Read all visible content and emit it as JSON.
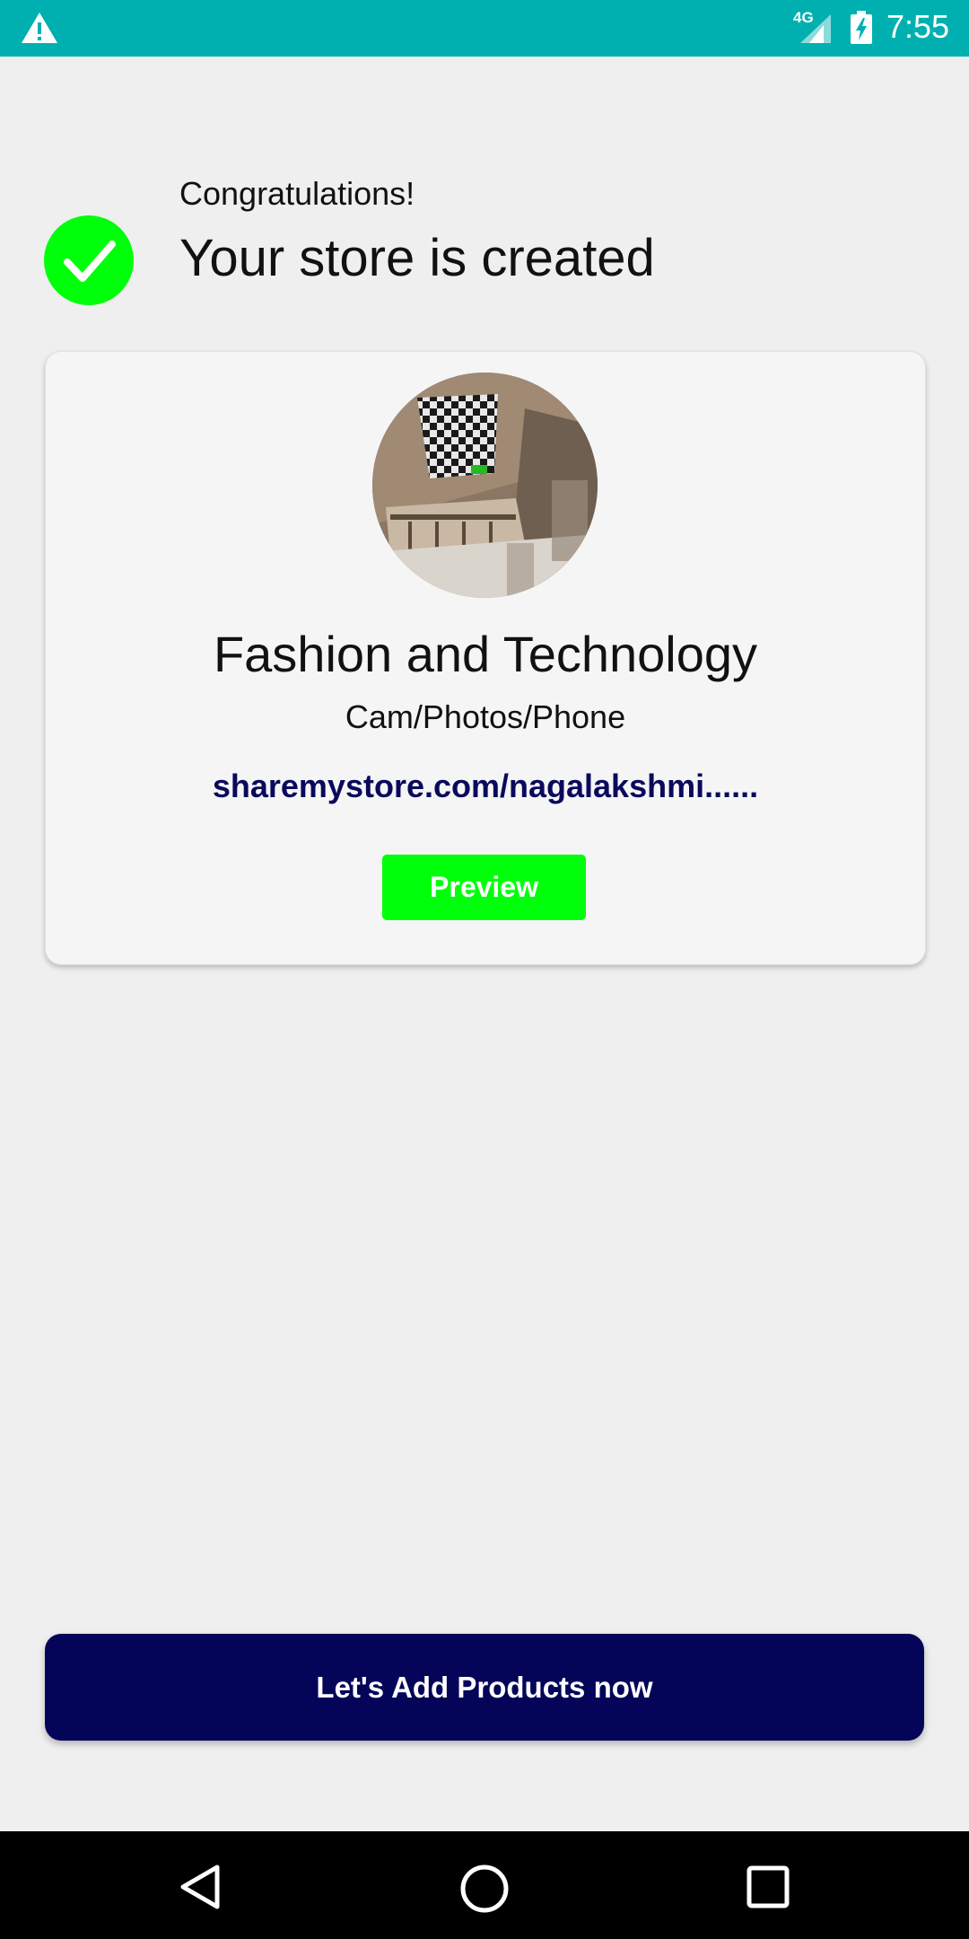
{
  "status_bar": {
    "network": "4G",
    "time": "7:55",
    "warning_icon": "warning-icon",
    "signal_icon": "signal-icon",
    "battery_icon": "battery-charging-icon"
  },
  "header": {
    "congrats": "Congratulations!",
    "message": "Your store is created",
    "check_icon": "check-circle-icon",
    "accent_color": "#00ff0a"
  },
  "store_card": {
    "name": "Fashion and Technology",
    "category": "Cam/Photos/Phone",
    "link": "sharemystore.com/nagalakshmi......",
    "preview_label": "Preview",
    "link_color": "#0a0a5c"
  },
  "cta": {
    "label": "Let's Add Products now",
    "color": "#040559"
  },
  "nav_bar": {
    "back_icon": "back-triangle-icon",
    "home_icon": "home-circle-icon",
    "recents_icon": "recents-square-icon"
  }
}
